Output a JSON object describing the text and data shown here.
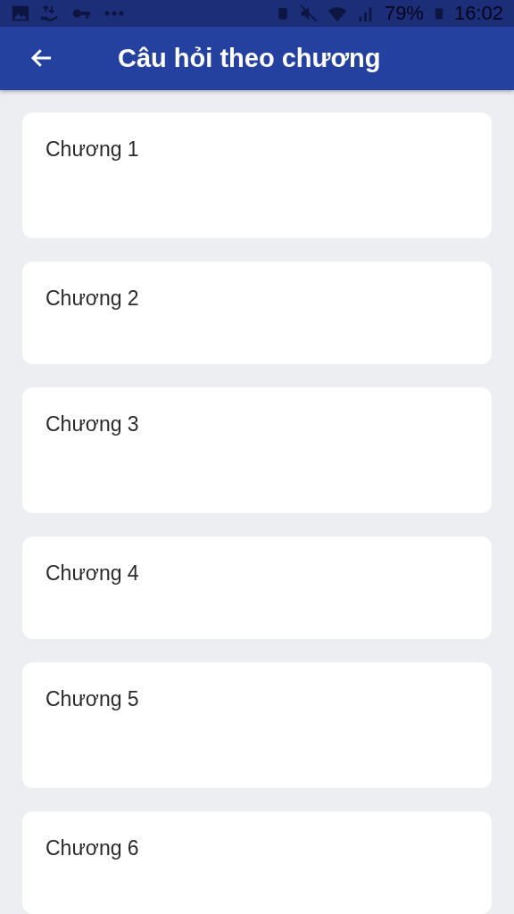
{
  "status_bar": {
    "battery": "79%",
    "time": "16:02"
  },
  "app_bar": {
    "title": "Câu hỏi theo chương"
  },
  "chapters": [
    {
      "label": "Chương 1"
    },
    {
      "label": "Chương 2"
    },
    {
      "label": "Chương 3"
    },
    {
      "label": "Chương 4"
    },
    {
      "label": "Chương 5"
    },
    {
      "label": "Chương 6"
    }
  ]
}
